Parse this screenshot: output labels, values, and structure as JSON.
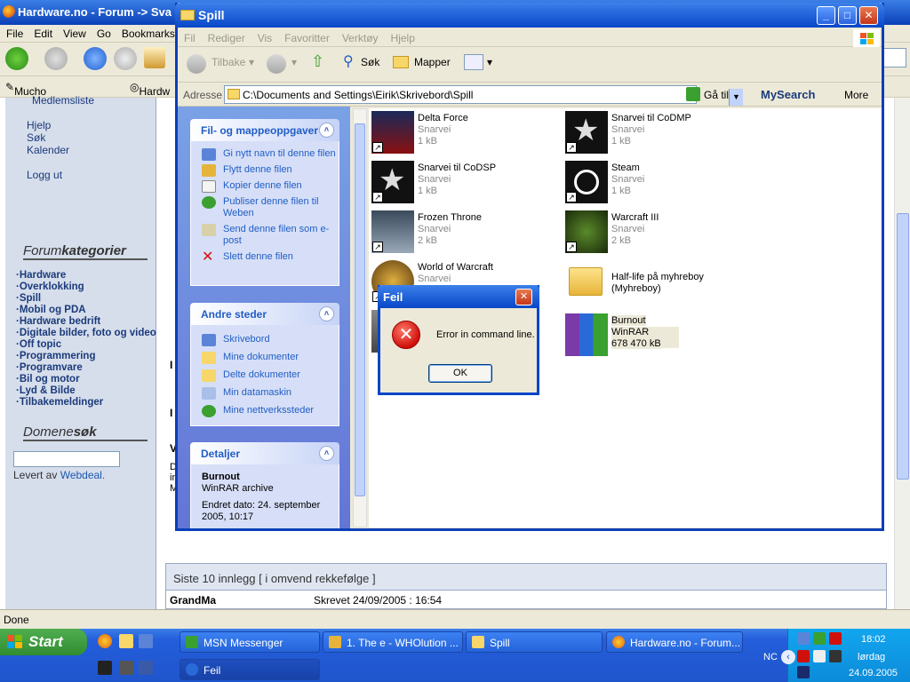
{
  "firefox": {
    "title": "Hardware.no - Forum -> Sva",
    "menu": [
      "File",
      "Edit",
      "View",
      "Go",
      "Bookmarks"
    ],
    "bookmarks": [
      "Mucho Sucko :: Tast...",
      "Hardw"
    ],
    "status": "Done"
  },
  "forum": {
    "top_links": [
      "Medlemsliste",
      "Hjelp",
      "Søk",
      "Kalender",
      "Logg ut"
    ],
    "categories_title_a": "Forum",
    "categories_title_b": "kategorier",
    "categories": [
      "Hardware",
      "Overklokking",
      "Spill",
      "Mobil og PDA",
      "Hardware bedrift",
      "Digitale bilder, foto og video",
      "Off topic",
      "Programmering",
      "Programvare",
      "Bil og motor",
      "Lyd & Bilde",
      "Tilbakemeldinger"
    ],
    "domain_title_a": "Domene",
    "domain_title_b": "søk",
    "credit_prefix": "Levert av",
    "credit_link": "Webdeal.",
    "latest_header": "Siste 10 innlegg [ i omvend rekkefølge ]",
    "latest_row": {
      "author": "GrandMa",
      "date": "Skrevet 24/09/2005 : 16:54"
    },
    "stray_letters": [
      "I",
      "I",
      "V",
      "D",
      "in",
      "M"
    ]
  },
  "explorer": {
    "title": "Spill",
    "menu": [
      "Fil",
      "Rediger",
      "Vis",
      "Favoritter",
      "Verktøy",
      "Hjelp"
    ],
    "toolbar": {
      "back": "Tilbake",
      "search": "Søk",
      "folders": "Mapper"
    },
    "address_label": "Adresse",
    "address": "C:\\Documents and Settings\\Eirik\\Skrivebord\\Spill",
    "goto": "Gå til",
    "mysearch": "MySearch",
    "more": "More"
  },
  "taskpane": {
    "file_tasks": {
      "title": "Fil- og mappeoppgaver",
      "items": [
        "Gi nytt navn til denne filen",
        "Flytt denne filen",
        "Kopier denne filen",
        "Publiser denne filen til Weben",
        "Send denne filen som e-post",
        "Slett denne filen"
      ]
    },
    "other_places": {
      "title": "Andre steder",
      "items": [
        "Skrivebord",
        "Mine dokumenter",
        "Delte dokumenter",
        "Min datamaskin",
        "Mine nettverkssteder"
      ]
    },
    "details": {
      "title": "Detaljer",
      "name": "Burnout",
      "type": "WinRAR archive",
      "modified": "Endret dato: 24. september 2005, 10:17"
    }
  },
  "files": [
    {
      "name": "Delta Force",
      "type": "Snarvei",
      "size": "1 kB",
      "icon": "delta-force-icon"
    },
    {
      "name": "Snarvei til CoDMP",
      "type": "Snarvei",
      "size": "1 kB",
      "icon": "star-icon"
    },
    {
      "name": "Snarvei til CoDSP",
      "type": "Snarvei",
      "size": "1 kB",
      "icon": "star-icon"
    },
    {
      "name": "Steam",
      "type": "Snarvei",
      "size": "1 kB",
      "icon": "steam-icon"
    },
    {
      "name": "Frozen Throne",
      "type": "Snarvei",
      "size": "2 kB",
      "icon": "frozen-throne-icon"
    },
    {
      "name": "Warcraft III",
      "type": "Snarvei",
      "size": "2 kB",
      "icon": "warcraft-icon"
    },
    {
      "name": "World of Warcraft",
      "type": "Snarvei",
      "size": "",
      "icon": "wow-icon"
    },
    {
      "name": "Half-life på myhreboy",
      "type": "(Myhreboy)",
      "size": "",
      "icon": "folder-icon"
    },
    {
      "name": "",
      "type": "",
      "size": "",
      "icon": "shortcut-icon"
    },
    {
      "name": "Burnout",
      "type": "WinRAR archive",
      "size": "678 470 kB",
      "icon": "winrar-icon"
    }
  ],
  "dialog": {
    "title": "Feil",
    "message": "Error in command line.",
    "ok": "OK"
  },
  "taskbar": {
    "start": "Start",
    "tasks": [
      "MSN Messenger",
      "1. The e - WHOlution ...",
      "Spill",
      "Hardware.no - Forum...",
      "Feil"
    ],
    "tray": {
      "time": "18:02",
      "day": "lørdag",
      "date": "24.09.2005",
      "lang": "NC"
    }
  },
  "colors": {
    "xp_blue": "#0846c8",
    "taskpane_link": "#215dc6",
    "start_green": "#328c32"
  }
}
